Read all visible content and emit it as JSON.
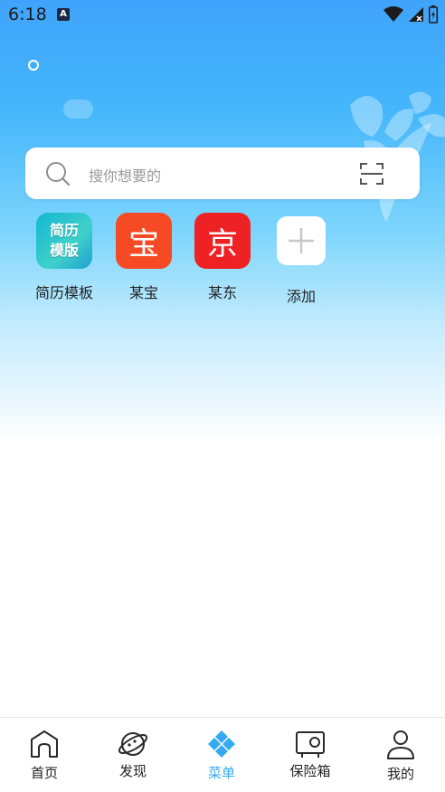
{
  "status_bar": {
    "time": "6:18",
    "notification_icon": "A"
  },
  "search": {
    "placeholder": "搜你想要的"
  },
  "shortcuts": [
    {
      "label": "简历模板",
      "tile_line1": "简历",
      "tile_line2": "模版",
      "icon": "resume-template-icon"
    },
    {
      "label": "某宝",
      "glyph": "宝",
      "icon": "bao-app-icon"
    },
    {
      "label": "某东",
      "glyph": "京",
      "icon": "jing-app-icon"
    },
    {
      "label": "添加",
      "icon": "add-icon"
    }
  ],
  "bottom_nav": [
    {
      "label": "首页",
      "icon": "home-icon",
      "active": false
    },
    {
      "label": "发现",
      "icon": "planet-icon",
      "active": false
    },
    {
      "label": "菜单",
      "icon": "menu-diamond-icon",
      "active": true
    },
    {
      "label": "保险箱",
      "icon": "safe-icon",
      "active": false
    },
    {
      "label": "我的",
      "icon": "profile-icon",
      "active": false
    }
  ],
  "colors": {
    "accent": "#35a9f1",
    "bao": "#f54a24",
    "jing": "#ee2225"
  }
}
